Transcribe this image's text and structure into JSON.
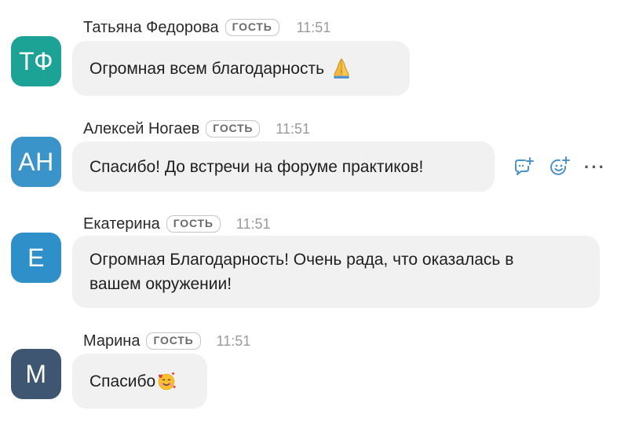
{
  "colors": {
    "avatar_tf": "#1ca395",
    "avatar_ah": "#3a93c9",
    "avatar_e": "#2f8fc8",
    "avatar_m": "#3f5673",
    "bubble_bg": "#f1f1f1",
    "action_icon": "#4b93c4"
  },
  "messages": [
    {
      "initials": "ТФ",
      "author": "Татьяна Федорова",
      "badge": "ГОСТЬ",
      "time": "11:51",
      "text": "Огромная всем благодарность",
      "emoji": "folded-hands-emoji"
    },
    {
      "initials": "АН",
      "author": "Алексей Ногаев",
      "badge": "ГОСТЬ",
      "time": "11:51",
      "text": "Спасибо! До встречи на форуме практиков!"
    },
    {
      "initials": "Е",
      "author": "Екатерина",
      "badge": "ГОСТЬ",
      "time": "11:51",
      "text": "Огромная Благодарность! Очень рада, что оказалась в\nвашем окружении!"
    },
    {
      "initials": "М",
      "author": "Марина",
      "badge": "ГОСТЬ",
      "time": "11:51",
      "text": "Спасибо",
      "emoji": "smiling-face-with-hearts-emoji"
    }
  ],
  "hover_actions": {
    "reply_icon": "reply-comment-icon",
    "react_icon": "add-reaction-icon",
    "more_label": "···"
  }
}
